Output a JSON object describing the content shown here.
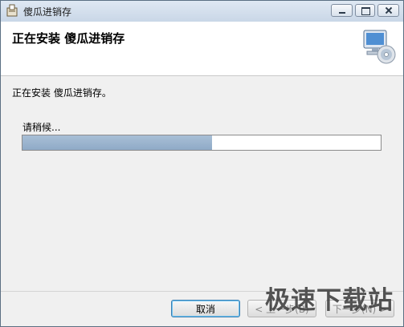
{
  "window": {
    "title": "傻瓜进销存",
    "app_icon": "installer-box-icon",
    "caption_buttons": [
      "minimize-icon",
      "maximize-icon",
      "close-icon"
    ]
  },
  "banner": {
    "title": "正在安装 傻瓜进销存",
    "icon": "computer-disc-icon"
  },
  "content": {
    "status": "正在安装 傻瓜进销存。",
    "wait_label": "请稍候...",
    "progress_fraction": 0.53
  },
  "footer": {
    "cancel_label": "取消",
    "back_label": "< 上一步(B)",
    "next_label": "下一步(N) >"
  },
  "watermark": {
    "text": "极速下载站"
  },
  "colors": {
    "progress_fill": "#9bb5d0",
    "titlebar": "#d4e0ee"
  }
}
